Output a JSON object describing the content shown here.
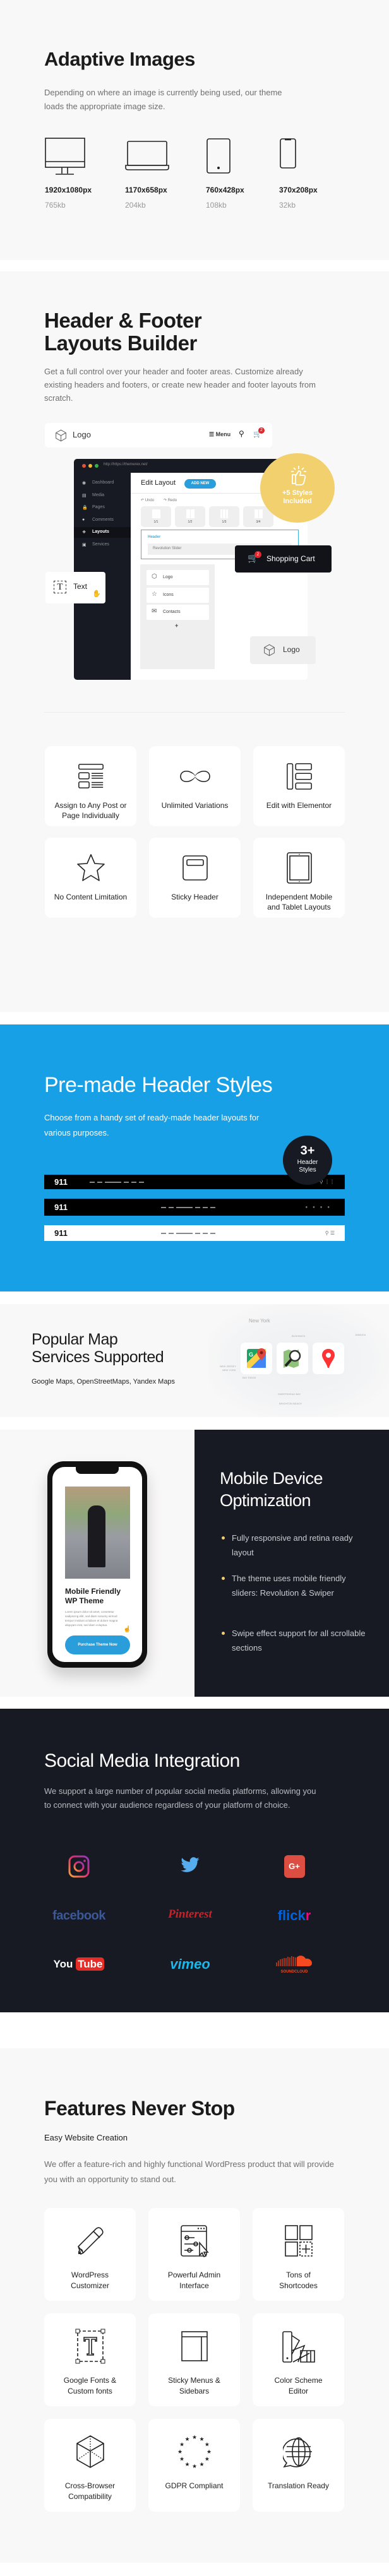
{
  "colors": {
    "accent_blue": "#18a0e6",
    "dark": "#171a23",
    "yellow": "#f2d06e",
    "light_bg": "#f9f8f8",
    "red_badge": "#e3262b"
  },
  "adaptive": {
    "title": "Adaptive Images",
    "description": "Depending on where an image is currently being used, our theme loads the appropriate image size.",
    "devices": [
      {
        "icon": "monitor-icon",
        "resolution": "1920x1080px",
        "size": "765kb"
      },
      {
        "icon": "laptop-icon",
        "resolution": "1170x658px",
        "size": "204kb"
      },
      {
        "icon": "tablet-icon",
        "resolution": "760x428px",
        "size": "108kb"
      },
      {
        "icon": "phone-icon",
        "resolution": "370x208px",
        "size": "32kb"
      }
    ]
  },
  "builder": {
    "title_lines": [
      "Header & Footer",
      "Layouts Builder"
    ],
    "description": "Get a full control over your header and footer areas. Customize already existing headers and footers, or create new header and footer layouts from scratch.",
    "mock": {
      "logo": "Logo",
      "menu": "Menu",
      "cart_count": "2",
      "url": "http://https://themerex.net/",
      "sidebar": [
        "Dashboard",
        "Media",
        "Pages",
        "Comments",
        "Layouts",
        "Services"
      ],
      "active_sidebar": "Layouts",
      "edit_title": "Edit Layout",
      "add_new": "ADD NEW",
      "undo": "Undo",
      "redo": "Redo",
      "columns": [
        "1/1",
        "1/2",
        "1/3",
        "3/4"
      ],
      "header_label": "Header",
      "slider": "Revolution Slider",
      "components": [
        "Logo",
        "Icons",
        "Contacts"
      ],
      "add": "+",
      "badge_text": "+5 Styles Included",
      "cart_label": "Shopping Cart",
      "text_label": "Text",
      "logo_card": "Logo"
    },
    "features": [
      {
        "icon": "layout-list",
        "label": "Assign to Any Post or Page Individually"
      },
      {
        "icon": "infinity",
        "label": "Unlimited Variations"
      },
      {
        "icon": "elementor",
        "label": "Edit with Elementor"
      },
      {
        "icon": "star",
        "label": "No Content Limitation"
      },
      {
        "icon": "sticky-header",
        "label": "Sticky Header"
      },
      {
        "icon": "tablet-outline",
        "label": "Independent Mobile and Tablet Layouts"
      }
    ]
  },
  "premade": {
    "title": "Pre-made Header Styles",
    "description": "Choose from a handy set of ready-made header layouts for various purposes.",
    "badge_number": "3+",
    "badge_label": "Header Styles",
    "bar_logo": "911"
  },
  "maps": {
    "title_lines": [
      "Popular Map",
      "Services Supported"
    ],
    "subtitle": "Google Maps, OpenStreetMaps, Yandex Maps",
    "map_labels": [
      "New York",
      "BUSHWICK",
      "NEW JERSEY",
      "NEW YORK",
      "BAY RIDGE",
      "SHEEPSHEAD BAY",
      "BRIGHTON BEACH",
      "JAMAICA"
    ],
    "services": [
      "google-maps-icon",
      "openstreetmap-icon",
      "yandex-maps-icon"
    ]
  },
  "mobile": {
    "phone": {
      "title": "Mobile Friendly WP Theme",
      "body": "Lorem ipsum dolor sit amet, consetetur sadipscing elitr, sed diam nonumy eirmod tempor invidunt ut labore et dolore magna aliquyam erat, sed diam voluptua.",
      "button": "Purchase Theme Now"
    },
    "title_lines": [
      "Mobile Device",
      "Optimization"
    ],
    "bullets": [
      "Fully responsive and retina ready layout",
      "The theme uses mobile friendly sliders: Revolution & Swiper",
      "Swipe effect support for all scrollable sections"
    ]
  },
  "social": {
    "title": "Social Media Integration",
    "description": "We support a large number of popular social media platforms, allowing you to connect with your audience regardless of your platform of choice.",
    "google_plus": "G+",
    "facebook": "facebook",
    "pinterest": "Pinterest",
    "flickr_a": "flick",
    "flickr_b": "r",
    "youtube_a": "You",
    "youtube_b": "Tube",
    "vimeo": "vimeo",
    "soundcloud": "SOUNDCLOUD"
  },
  "features": {
    "title": "Features Never Stop",
    "subtitle": "Easy Website Creation",
    "description": "We offer a feature-rich and highly functional WordPress product that will provide you with an opportunity to stand out.",
    "items": [
      {
        "icon": "pencil",
        "label": "WordPress Customizer"
      },
      {
        "icon": "admin",
        "label": "Powerful Admin Interface"
      },
      {
        "icon": "shortcodes",
        "label": "Tons of Shortcodes"
      },
      {
        "icon": "font-t",
        "label": "Google Fonts & Custom fonts"
      },
      {
        "icon": "sidebar",
        "label": "Sticky Menus & Sidebars"
      },
      {
        "icon": "palette",
        "label": "Color Scheme Editor"
      },
      {
        "icon": "cube",
        "label": "Cross-Browser Compatibility"
      },
      {
        "icon": "eu-stars",
        "label": "GDPR Compliant"
      },
      {
        "icon": "globe-chat",
        "label": "Translation Ready"
      }
    ]
  }
}
